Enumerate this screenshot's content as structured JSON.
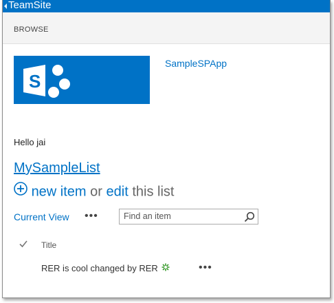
{
  "suite_bar": {
    "title": "TeamSite",
    "color": "#0072c6"
  },
  "ribbon": {
    "tab_browse": "BROWSE"
  },
  "site": {
    "title": "SampleSPApp",
    "logo_icon": "sharepoint-logo-icon"
  },
  "page": {
    "greeting": "Hello jai"
  },
  "list": {
    "title": "MySampleList",
    "new_item": "new item",
    "or_text": "or",
    "edit": "edit",
    "this_list": "this list",
    "current_view": "Current View",
    "view_more": "•••",
    "search_placeholder": "Find an item",
    "columns": {
      "title": "Title"
    },
    "rows": [
      {
        "title": "RER is cool changed by RER",
        "more": "•••",
        "is_new": true
      }
    ]
  },
  "colors": {
    "accent": "#0072c6",
    "new_badge": "#3a9b2f"
  }
}
